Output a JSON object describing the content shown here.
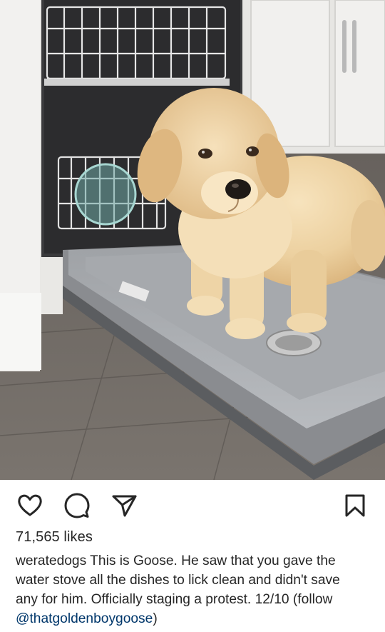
{
  "post": {
    "image_alt": "Golden retriever puppy standing on an open dishwasher door",
    "likes_text": "71,565 likes",
    "caption": {
      "username": "weratedogs",
      "line1": " This is Goose. He saw that you gave the",
      "line2": "water stove all the dishes to lick clean and didn't save",
      "line3": "any for him. Officially staging a protest. 12/10 (follow",
      "mention": "@thatgoldenboygoose",
      "after_mention": ")"
    }
  },
  "icons": {
    "like": "heart-icon",
    "comment": "comment-bubble-icon",
    "share": "paper-plane-icon",
    "save": "bookmark-icon"
  },
  "colors": {
    "text": "#262626",
    "mention": "#00376b"
  }
}
